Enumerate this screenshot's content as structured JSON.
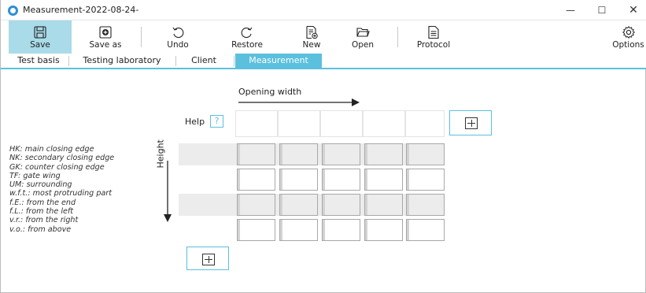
{
  "window": {
    "title": "Measurement-2022-08-24-",
    "controls": {
      "minimize": "—",
      "maximize": "☐",
      "close": "✕"
    }
  },
  "toolbar": {
    "save": "Save",
    "save_as": "Save as",
    "undo": "Undo",
    "restore": "Restore",
    "new": "New",
    "open": "Open",
    "protocol": "Protocol",
    "options": "Options"
  },
  "tabs": {
    "test_basis": "Test basis",
    "testing_laboratory": "Testing laboratory",
    "client": "Client",
    "measurement": "Measurement",
    "active": "Measurement"
  },
  "grid": {
    "opening_width_label": "Opening width",
    "help_label": "Help",
    "help_icon_text": "?",
    "height_label": "Height"
  },
  "legend": [
    "HK: main closing edge",
    "NK: secondary closing edge",
    "GK: counter closing edge",
    "TF: gate wing",
    "UM: surrounding",
    "w.f.t.: most protruding part",
    "f.E.: from the end",
    "f.L.: from the left",
    "v.r.: from the right",
    "v.o.: from above"
  ],
  "colors": {
    "accent": "#5bc0de",
    "save_highlight": "#a9dbe9",
    "shaded_row": "#ececec"
  }
}
